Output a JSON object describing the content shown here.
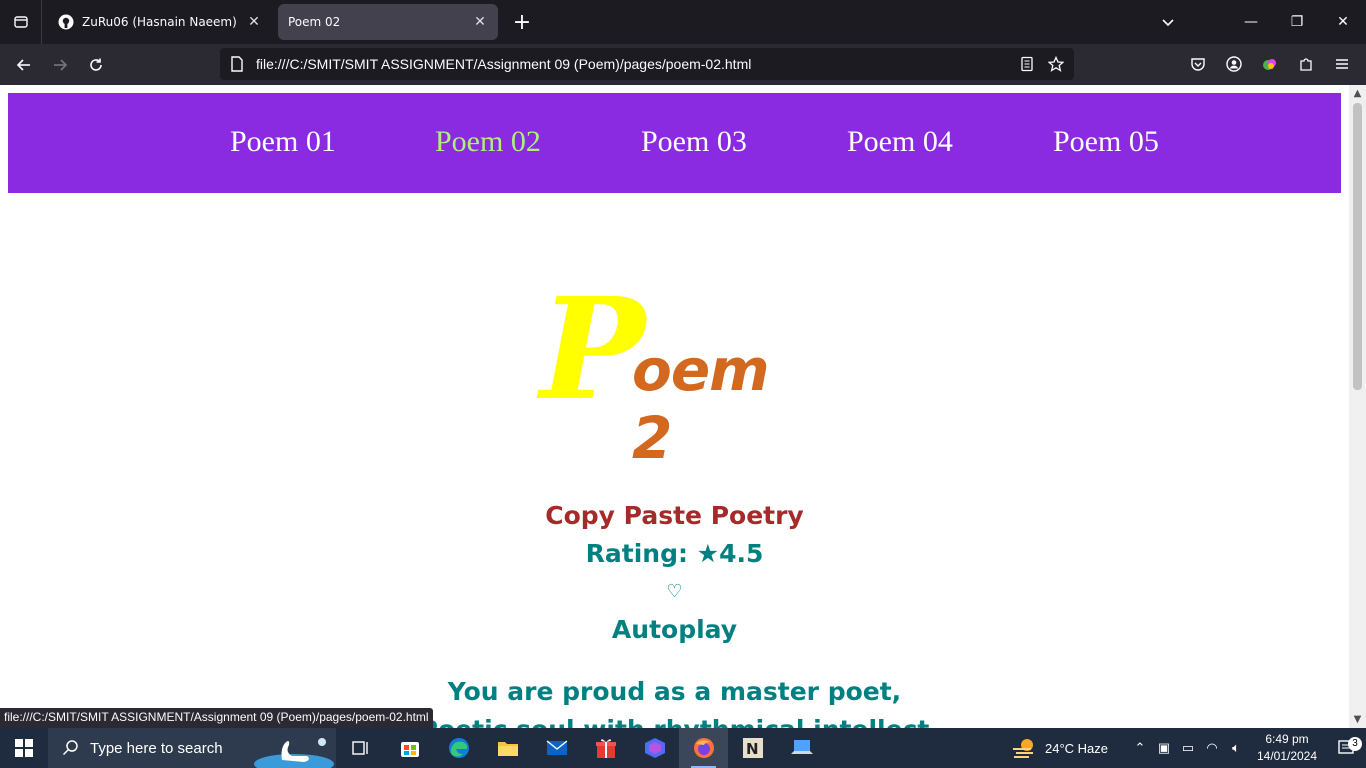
{
  "browser": {
    "tabs": [
      {
        "label": "ZuRu06 (Hasnain Naeem)",
        "icon": "github-icon"
      },
      {
        "label": "Poem 02",
        "icon": null,
        "active": true
      }
    ],
    "url": "file:///C:/SMIT/SMIT ASSIGNMENT/Assignment 09 (Poem)/pages/poem-02.html",
    "status_url": "file:///C:/SMIT/SMIT ASSIGNMENT/Assignment 09 (Poem)/pages/poem-02.html"
  },
  "page": {
    "nav": [
      {
        "label": "Poem 01"
      },
      {
        "label": "Poem 02",
        "active": true
      },
      {
        "label": "Poem 03"
      },
      {
        "label": "Poem 04"
      },
      {
        "label": "Poem 05"
      }
    ],
    "hero": {
      "initial": "P",
      "rest": "oem 2"
    },
    "subtitle": "Copy Paste Poetry",
    "rating": "Rating: ★4.5",
    "heart": "♡",
    "autoplay": "Autoplay",
    "lines": [
      "You are proud as a master poet,",
      "Poetic soul with rhythmical intellect"
    ]
  },
  "taskbar": {
    "search_placeholder": "Type here to search",
    "weather": "24°C  Haze",
    "time": "6:49 pm",
    "date": "14/01/2024",
    "notifications": "3"
  },
  "colors": {
    "nav_bg": "#8a2be2",
    "nav_active": "#adf07e",
    "hero_initial": "#ffff00",
    "hero_rest": "#d2691e",
    "subtitle": "#a52a2a",
    "teal": "#008080"
  }
}
